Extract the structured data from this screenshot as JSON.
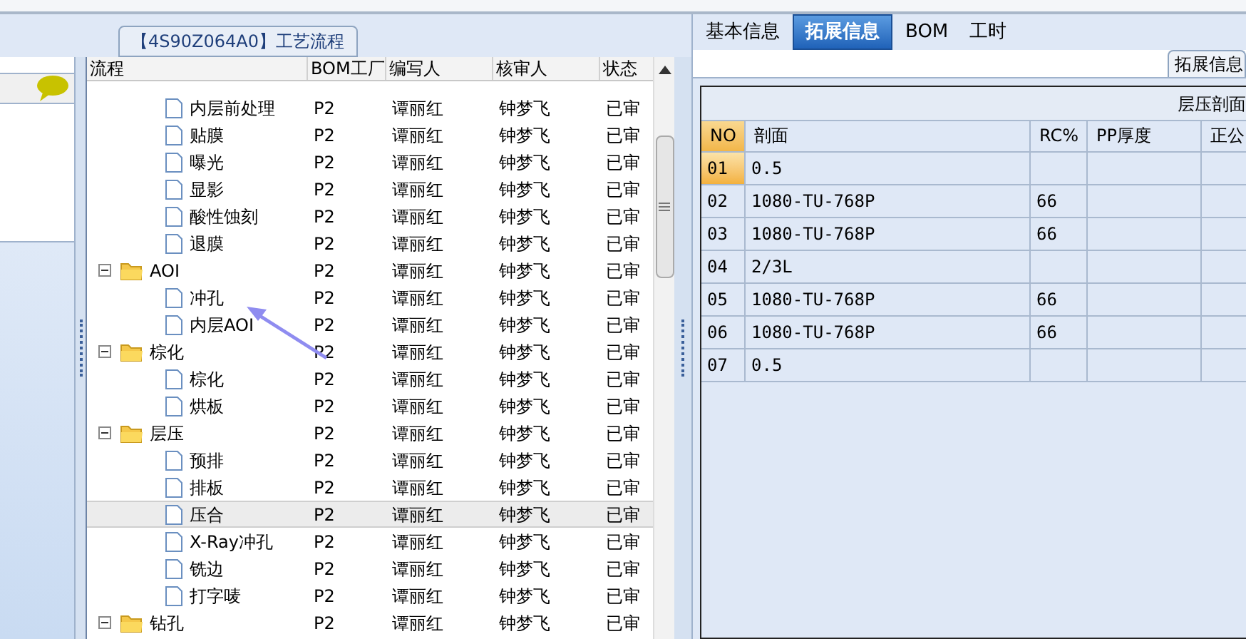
{
  "group_title": "【4S90Z064A0】工艺流程",
  "tree": {
    "columns": [
      "流程",
      "BOM工厂",
      "编写人",
      "核审人",
      "状态"
    ],
    "items": [
      {
        "children": [
          {
            "kind": "step",
            "label": "内层前处理",
            "bom": "P2",
            "writer": "谭丽红",
            "reviewer": "钟梦飞",
            "status": "已审",
            "selected": false
          },
          {
            "kind": "step",
            "label": "贴膜",
            "bom": "P2",
            "writer": "谭丽红",
            "reviewer": "钟梦飞",
            "status": "已审",
            "selected": false
          },
          {
            "kind": "step",
            "label": "曝光",
            "bom": "P2",
            "writer": "谭丽红",
            "reviewer": "钟梦飞",
            "status": "已审",
            "selected": false
          },
          {
            "kind": "step",
            "label": "显影",
            "bom": "P2",
            "writer": "谭丽红",
            "reviewer": "钟梦飞",
            "status": "已审",
            "selected": false
          },
          {
            "kind": "step",
            "label": "酸性蚀刻",
            "bom": "P2",
            "writer": "谭丽红",
            "reviewer": "钟梦飞",
            "status": "已审",
            "selected": false
          },
          {
            "kind": "step",
            "label": "退膜",
            "bom": "P2",
            "writer": "谭丽红",
            "reviewer": "钟梦飞",
            "status": "已审",
            "selected": false
          }
        ]
      },
      {
        "kind": "folder",
        "label": "AOI",
        "bom": "P2",
        "writer": "谭丽红",
        "reviewer": "钟梦飞",
        "status": "已审",
        "selected": false,
        "expanded": true,
        "children": [
          {
            "kind": "step",
            "label": "冲孔",
            "bom": "P2",
            "writer": "谭丽红",
            "reviewer": "钟梦飞",
            "status": "已审",
            "selected": false
          },
          {
            "kind": "step",
            "label": "内层AOI",
            "bom": "P2",
            "writer": "谭丽红",
            "reviewer": "钟梦飞",
            "status": "已审",
            "selected": false
          }
        ]
      },
      {
        "kind": "folder",
        "label": "棕化",
        "bom": "P2",
        "writer": "谭丽红",
        "reviewer": "钟梦飞",
        "status": "已审",
        "selected": false,
        "expanded": true,
        "children": [
          {
            "kind": "step",
            "label": "棕化",
            "bom": "P2",
            "writer": "谭丽红",
            "reviewer": "钟梦飞",
            "status": "已审",
            "selected": false
          },
          {
            "kind": "step",
            "label": "烘板",
            "bom": "P2",
            "writer": "谭丽红",
            "reviewer": "钟梦飞",
            "status": "已审",
            "selected": false
          }
        ]
      },
      {
        "kind": "folder",
        "label": "层压",
        "bom": "P2",
        "writer": "谭丽红",
        "reviewer": "钟梦飞",
        "status": "已审",
        "selected": false,
        "expanded": true,
        "children": [
          {
            "kind": "step",
            "label": "预排",
            "bom": "P2",
            "writer": "谭丽红",
            "reviewer": "钟梦飞",
            "status": "已审",
            "selected": false
          },
          {
            "kind": "step",
            "label": "排板",
            "bom": "P2",
            "writer": "谭丽红",
            "reviewer": "钟梦飞",
            "status": "已审",
            "selected": false
          },
          {
            "kind": "step",
            "label": "压合",
            "bom": "P2",
            "writer": "谭丽红",
            "reviewer": "钟梦飞",
            "status": "已审",
            "selected": true
          },
          {
            "kind": "step",
            "label": "X-Ray冲孔",
            "bom": "P2",
            "writer": "谭丽红",
            "reviewer": "钟梦飞",
            "status": "已审",
            "selected": false
          },
          {
            "kind": "step",
            "label": "铣边",
            "bom": "P2",
            "writer": "谭丽红",
            "reviewer": "钟梦飞",
            "status": "已审",
            "selected": false
          },
          {
            "kind": "step",
            "label": "打字唛",
            "bom": "P2",
            "writer": "谭丽红",
            "reviewer": "钟梦飞",
            "status": "已审",
            "selected": false
          }
        ]
      },
      {
        "kind": "folder",
        "label": "钻孔",
        "bom": "P2",
        "writer": "谭丽红",
        "reviewer": "钟梦飞",
        "status": "已审",
        "selected": false,
        "expanded": true
      }
    ]
  },
  "tabs": [
    {
      "label": "基本信息",
      "selected": false
    },
    {
      "label": "拓展信息",
      "selected": true
    },
    {
      "label": "BOM",
      "selected": false
    },
    {
      "label": "工时",
      "selected": false
    }
  ],
  "ext_group_title": "拓展信息",
  "laminate": {
    "title": "层压剖面",
    "columns": [
      "NO",
      "剖面",
      "RC%",
      "PP厚度",
      "正公"
    ],
    "rows": [
      {
        "no": "01",
        "section": "0.5",
        "selected": true
      },
      {
        "no": "02",
        "section": "1080-TU-768P",
        "rc": "66",
        "selected": false
      },
      {
        "no": "03",
        "section": "1080-TU-768P",
        "rc": "66",
        "selected": false
      },
      {
        "no": "04",
        "section": "2/3L",
        "selected": false
      },
      {
        "no": "05",
        "section": "1080-TU-768P",
        "rc": "66",
        "selected": false
      },
      {
        "no": "06",
        "section": "1080-TU-768P",
        "rc": "66",
        "selected": false
      },
      {
        "no": "07",
        "section": "0.5",
        "selected": false
      }
    ]
  }
}
